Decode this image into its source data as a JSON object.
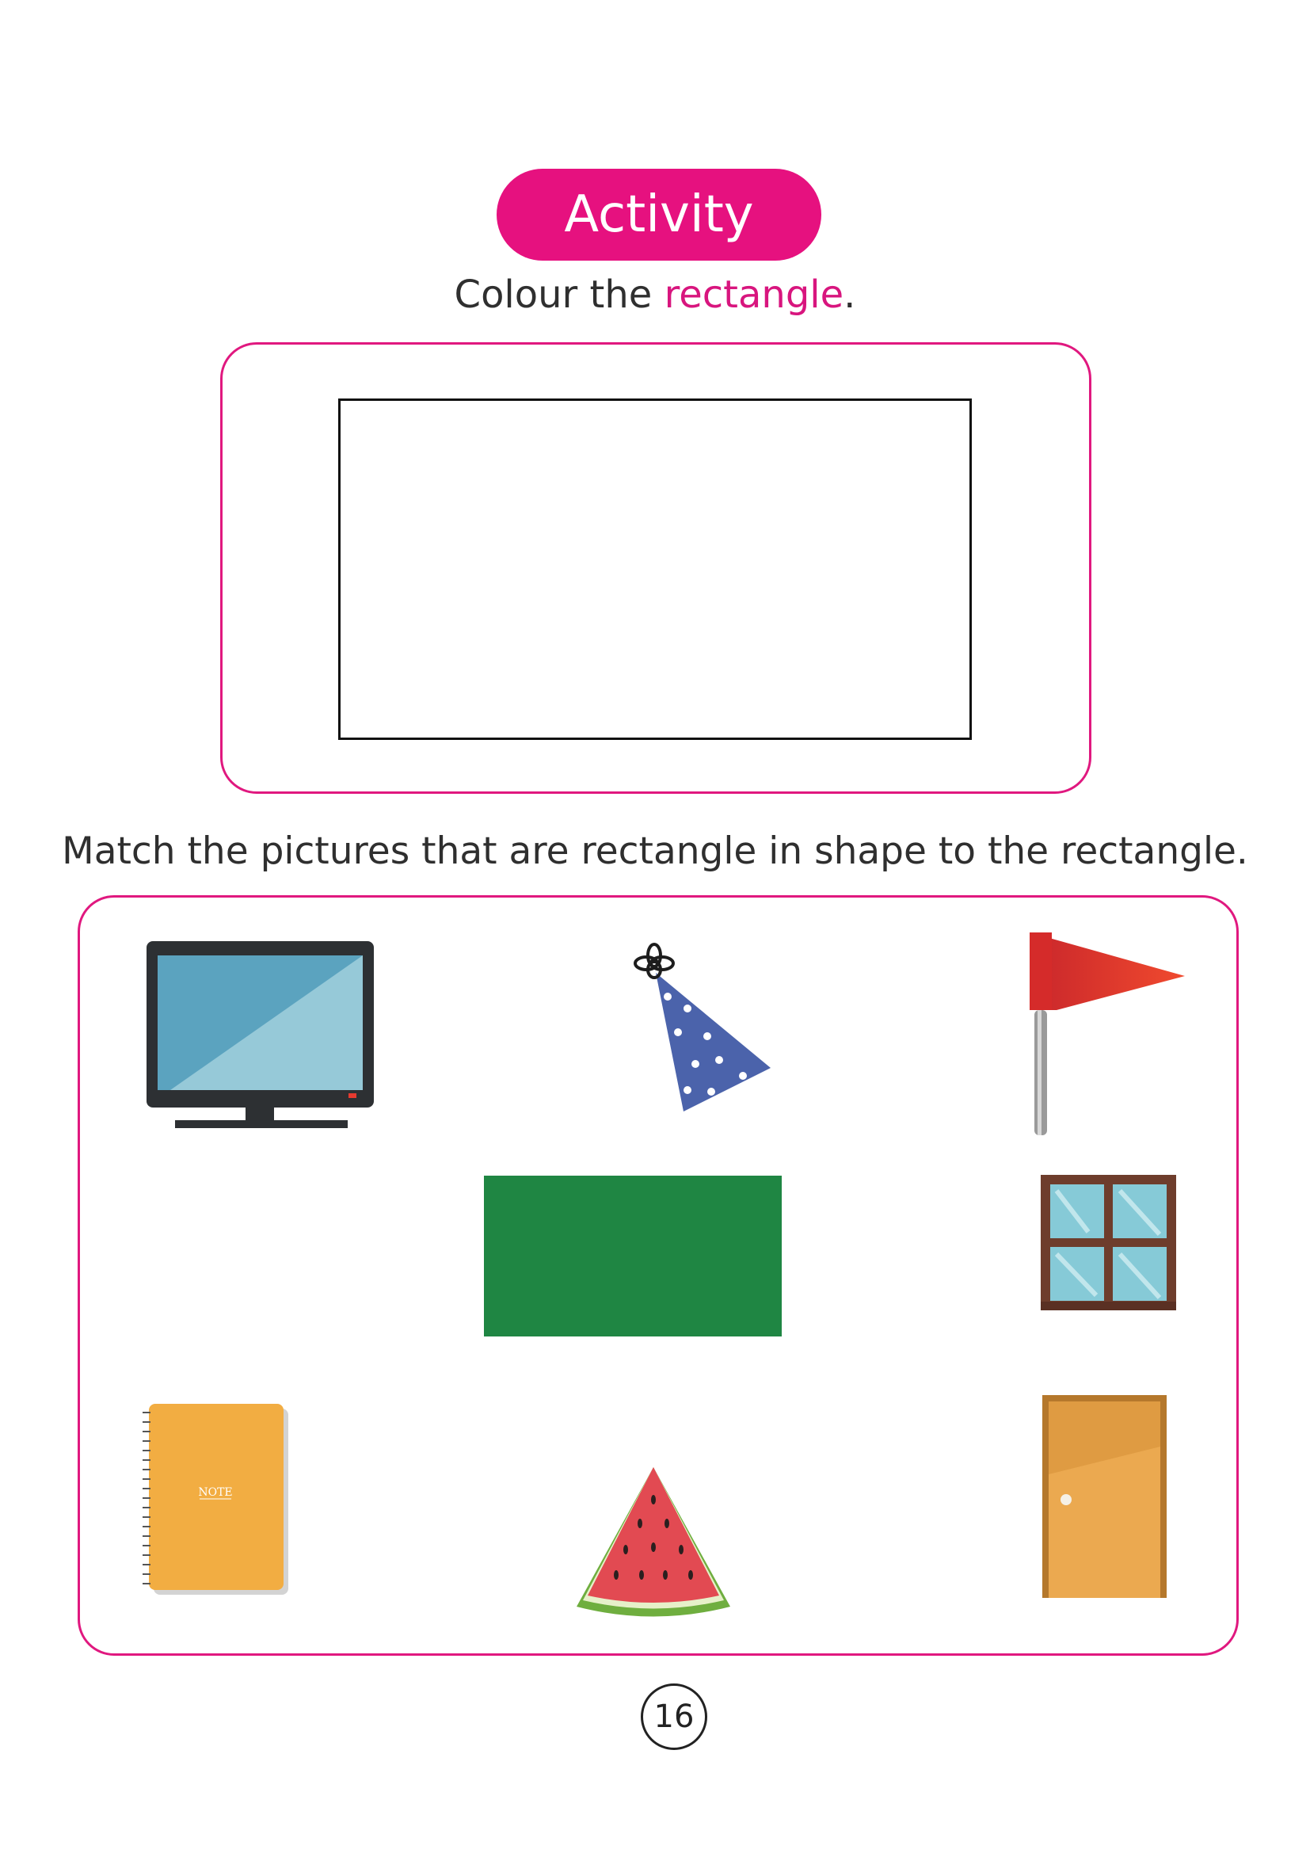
{
  "header": {
    "badge": "Activity"
  },
  "task1": {
    "prefix": "Colour the ",
    "highlight": "rectangle",
    "suffix": "."
  },
  "task2": {
    "instruction": "Match the pictures that are rectangle in shape to the rectangle."
  },
  "pictures": [
    {
      "name": "television",
      "icon": "television-icon"
    },
    {
      "name": "party hat",
      "icon": "party-hat-icon"
    },
    {
      "name": "flag",
      "icon": "flag-icon"
    },
    {
      "name": "rectangle",
      "icon": "green-rectangle-icon"
    },
    {
      "name": "window",
      "icon": "window-icon"
    },
    {
      "name": "notebook",
      "icon": "notebook-icon",
      "label": "NOTE"
    },
    {
      "name": "watermelon slice",
      "icon": "watermelon-icon"
    },
    {
      "name": "door",
      "icon": "door-icon"
    }
  ],
  "footer": {
    "page_number": "16"
  },
  "colors": {
    "accent": "#e6117f",
    "green_rect": "#1f8643"
  }
}
